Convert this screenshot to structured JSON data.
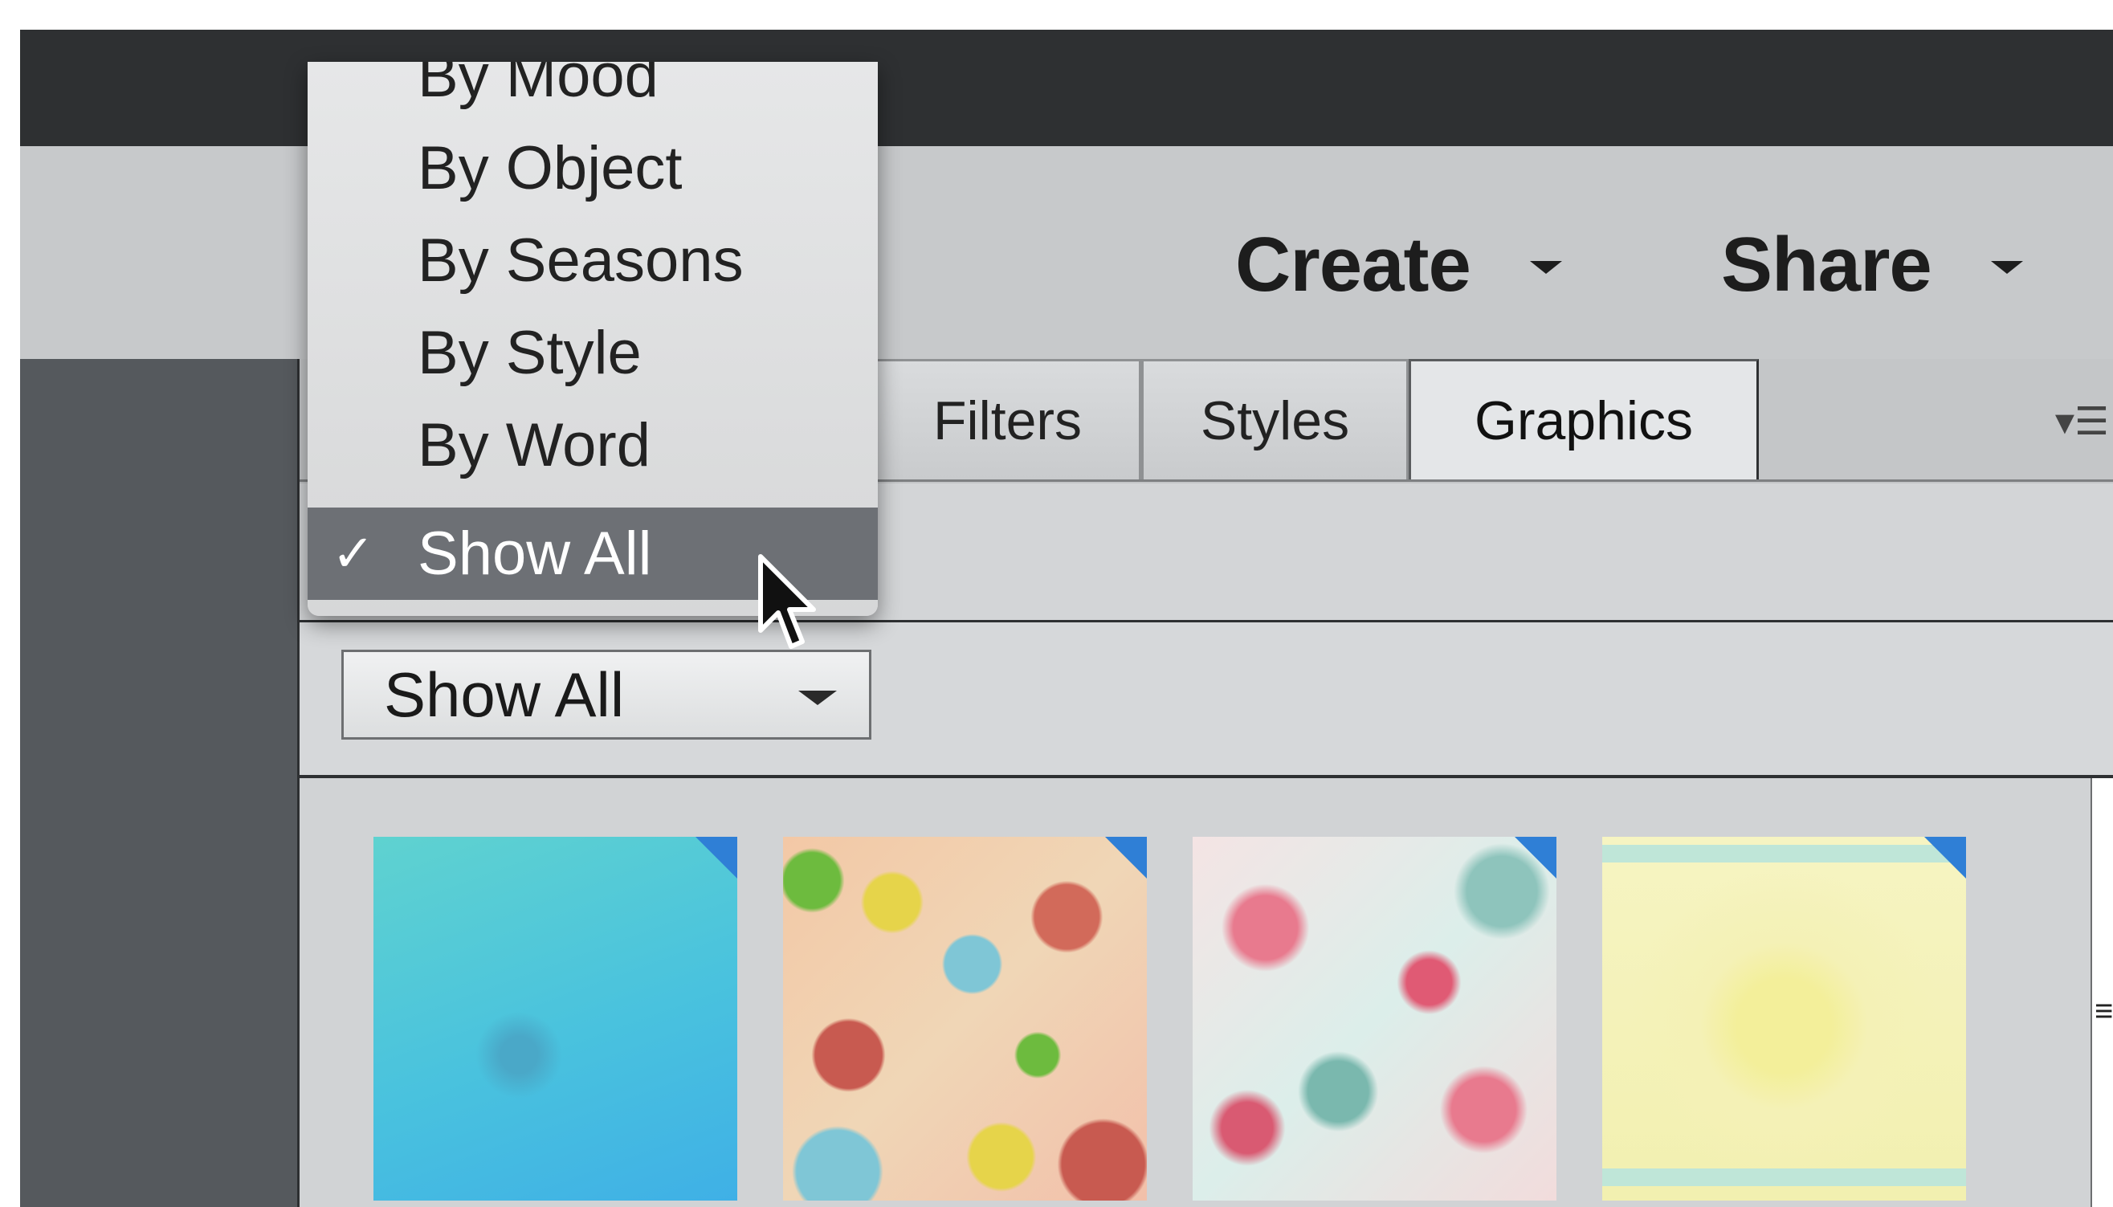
{
  "header": {
    "actions": [
      {
        "label": "Create"
      },
      {
        "label": "Share"
      }
    ]
  },
  "panel": {
    "tabs": [
      {
        "label": "Filters",
        "active": false
      },
      {
        "label": "Styles",
        "active": false
      },
      {
        "label": "Graphics",
        "active": true
      }
    ],
    "menu_icon": "panel-menu-icon",
    "filter_select": {
      "value": "Show All"
    }
  },
  "dropdown": {
    "items": [
      {
        "label": "By Mood",
        "selected": false
      },
      {
        "label": "By Object",
        "selected": false
      },
      {
        "label": "By Seasons",
        "selected": false
      },
      {
        "label": "By Style",
        "selected": false
      },
      {
        "label": "By Word",
        "selected": false
      },
      {
        "label": "Show All",
        "selected": true
      }
    ],
    "check_glyph": "✓"
  },
  "thumbnails": [
    {
      "name": "cyan-watercolor"
    },
    {
      "name": "pastel-roses"
    },
    {
      "name": "pink-teal-splatter"
    },
    {
      "name": "yellow-texture"
    }
  ],
  "colors": {
    "titlebar": "#2e3032",
    "selected_item": "#6d7075",
    "thumbnail_corner": "#2f7fd6"
  }
}
